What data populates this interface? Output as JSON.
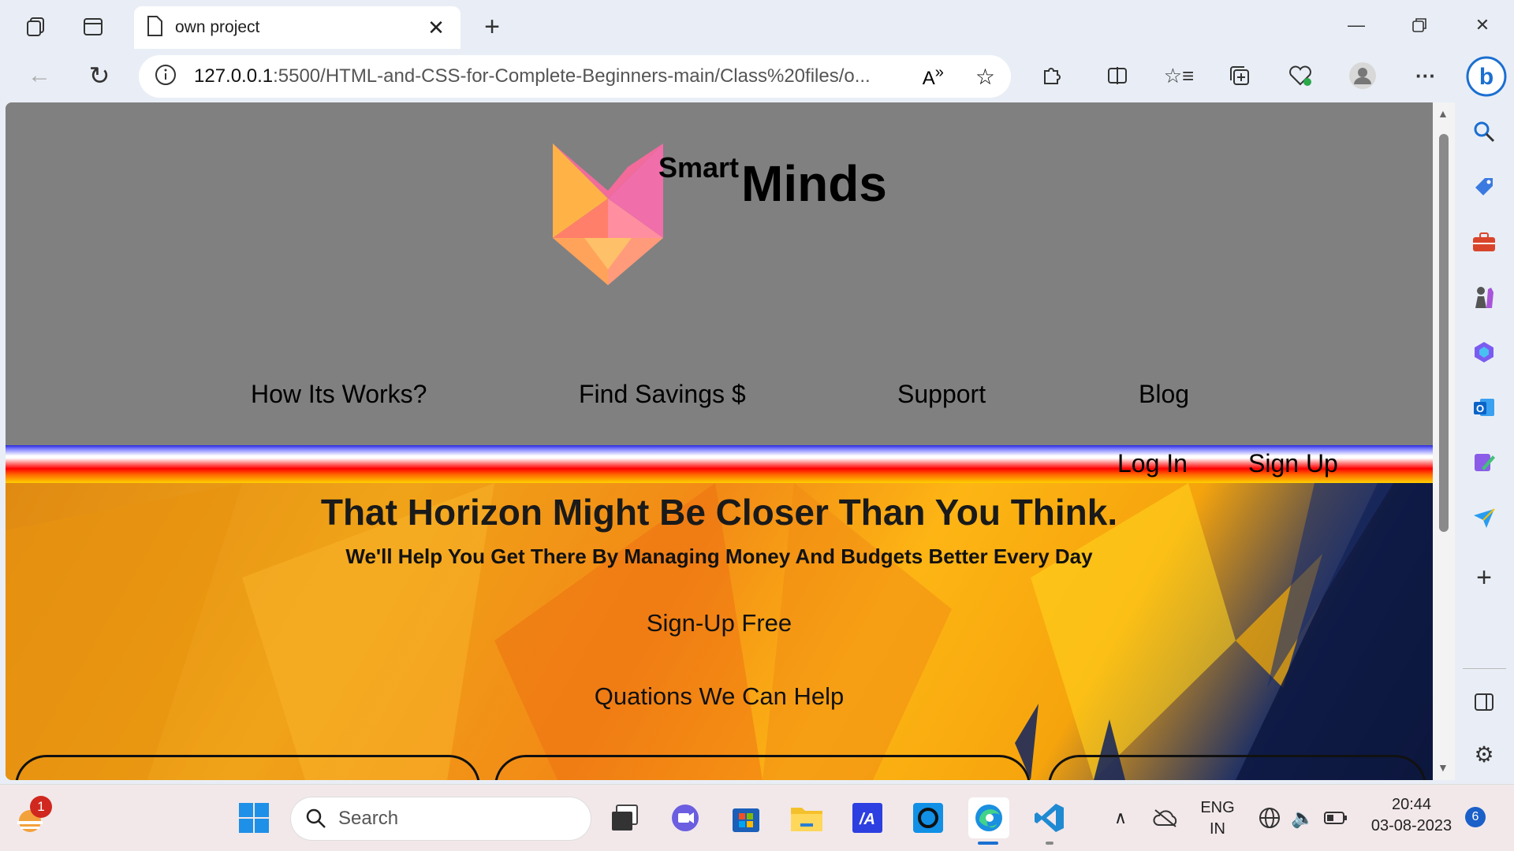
{
  "browser": {
    "tab_title": "own project",
    "url_host": "127.0.0.1",
    "url_rest": ":5500/HTML-and-CSS-for-Complete-Beginners-main/Class%20files/o..."
  },
  "site": {
    "brand_small": "Smart",
    "brand_big": "Minds",
    "nav": [
      "How Its Works?",
      "Find Savings $",
      "Support",
      "Blog"
    ],
    "auth": {
      "login": "Log In",
      "signup": "Sign Up"
    },
    "hero": {
      "headline": "That Horizon Might Be Closer Than You Think.",
      "subheadline": "We'll Help You Get There By Managing Money And Budgets Better Every Day",
      "signup_free": "Sign-Up Free",
      "questions": "Quations We Can Help"
    }
  },
  "taskbar": {
    "search_placeholder": "Search",
    "notification_count": "1",
    "lang_line1": "ENG",
    "lang_line2": "IN",
    "time": "20:44",
    "date": "03-08-2023",
    "badge": "6"
  }
}
